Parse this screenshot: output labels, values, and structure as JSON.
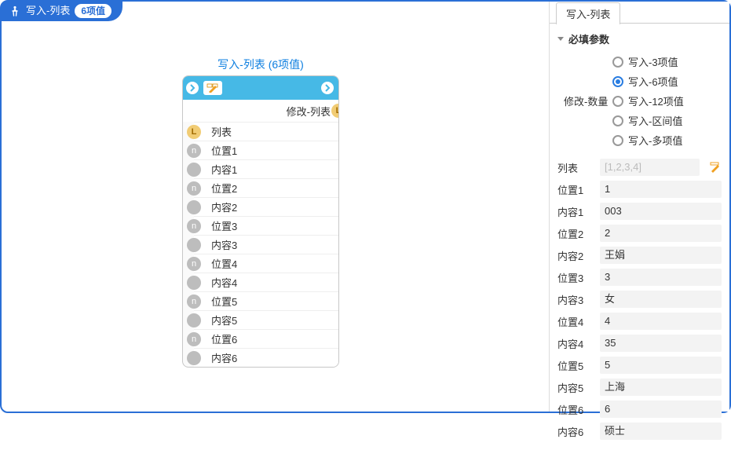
{
  "header": {
    "title": "写入-列表",
    "count_label": "6项值"
  },
  "node": {
    "title": "写入-列表 (6项值)",
    "output_label": "修改-列表",
    "output_port": "L",
    "inputs": [
      {
        "port": "L",
        "label": "列表"
      },
      {
        "port": "n",
        "label": "位置1"
      },
      {
        "port": "",
        "label": "内容1"
      },
      {
        "port": "n",
        "label": "位置2"
      },
      {
        "port": "",
        "label": "内容2"
      },
      {
        "port": "n",
        "label": "位置3"
      },
      {
        "port": "",
        "label": "内容3"
      },
      {
        "port": "n",
        "label": "位置4"
      },
      {
        "port": "",
        "label": "内容4"
      },
      {
        "port": "n",
        "label": "位置5"
      },
      {
        "port": "",
        "label": "内容5"
      },
      {
        "port": "n",
        "label": "位置6"
      },
      {
        "port": "",
        "label": "内容6"
      }
    ]
  },
  "panel": {
    "tab_label": "写入-列表",
    "section_label": "必填参数",
    "radio_side_label": "修改-数量",
    "radios": [
      {
        "label": "写入-3项值",
        "checked": false
      },
      {
        "label": "写入-6项值",
        "checked": true
      },
      {
        "label": "写入-12项值",
        "checked": false
      },
      {
        "label": "写入-区间值",
        "checked": false
      },
      {
        "label": "写入-多项值",
        "checked": false
      }
    ],
    "list_field": {
      "label": "列表",
      "placeholder": "[1,2,3,4]"
    },
    "fields": [
      {
        "label": "位置1",
        "value": "1"
      },
      {
        "label": "内容1",
        "value": "003"
      },
      {
        "label": "位置2",
        "value": "2"
      },
      {
        "label": "内容2",
        "value": "王娟"
      },
      {
        "label": "位置3",
        "value": "3"
      },
      {
        "label": "内容3",
        "value": "女"
      },
      {
        "label": "位置4",
        "value": "4"
      },
      {
        "label": "内容4",
        "value": "35"
      },
      {
        "label": "位置5",
        "value": "5"
      },
      {
        "label": "内容5",
        "value": "上海"
      },
      {
        "label": "位置6",
        "value": "6"
      },
      {
        "label": "内容6",
        "value": "硕士"
      }
    ]
  }
}
